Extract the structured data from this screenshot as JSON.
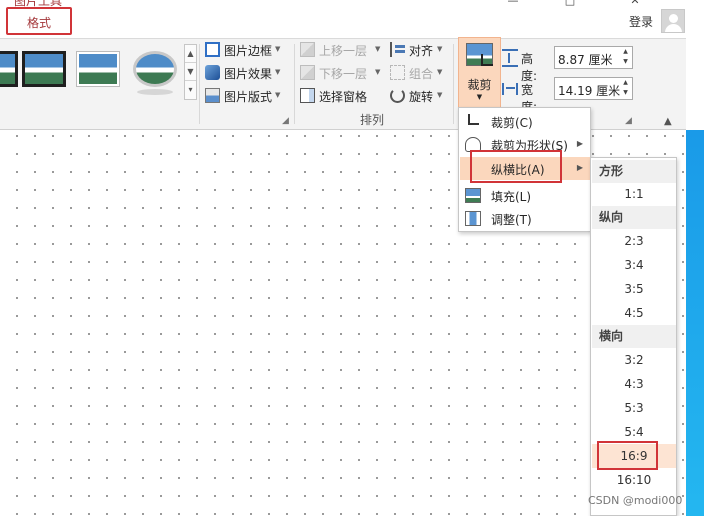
{
  "titlebar": {
    "context_label": "图片工具",
    "tab_format": "格式",
    "minimize": "—",
    "login": "登录"
  },
  "style_gallery": {
    "scroll_up": "▲",
    "scroll_down": "▼",
    "more": "▾"
  },
  "picture_styles": {
    "border": "图片边框",
    "effect": "图片效果",
    "layout": "图片版式"
  },
  "arrange": {
    "bring_forward": "上移一层",
    "send_backward": "下移一层",
    "selection_pane": "选择窗格",
    "align": "对齐",
    "group": "组合",
    "rotate": "旋转",
    "group_label": "排列"
  },
  "size": {
    "crop_label": "裁剪",
    "height_label": "高度:",
    "height_value": "8.87 厘米",
    "width_label": "宽度:",
    "width_value": "14.19 厘米"
  },
  "crop_menu": {
    "items": [
      {
        "label": "裁剪(C)",
        "icon": "crop-icon"
      },
      {
        "label": "裁剪为形状(S)",
        "icon": "crop-shape-icon",
        "submenu": true
      },
      {
        "label": "纵横比(A)",
        "icon": "",
        "submenu": true,
        "highlighted": true
      },
      {
        "label": "填充(L)",
        "icon": "fill-icon"
      },
      {
        "label": "调整(T)",
        "icon": "fit-icon"
      }
    ]
  },
  "aspect_ratio_menu": {
    "square_header": "方形",
    "square_items": [
      "1:1"
    ],
    "portrait_header": "纵向",
    "portrait_items": [
      "2:3",
      "3:4",
      "3:5",
      "4:5"
    ],
    "landscape_header": "横向",
    "landscape_items": [
      "3:2",
      "4:3",
      "5:3",
      "5:4",
      "16:9",
      "16:10"
    ],
    "selected": "16:9"
  },
  "watermark": "CSDN @modi000",
  "colors": {
    "accent": "#a4373a",
    "highlight": "#fbd7bd",
    "annotation_red": "#d13438"
  }
}
